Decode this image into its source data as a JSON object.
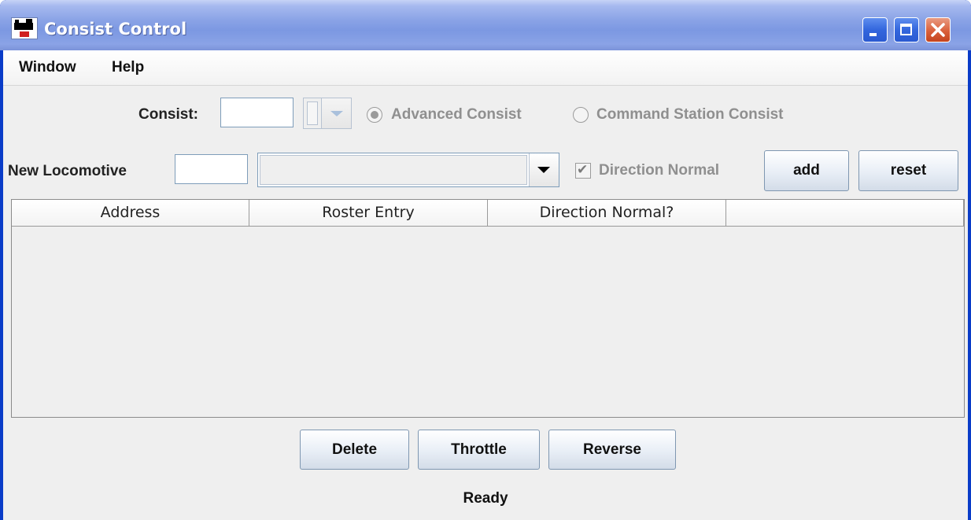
{
  "window": {
    "title": "Consist Control",
    "title_gradient_color": "#7c98e2",
    "close_button_color": "#d9603b"
  },
  "menubar": {
    "items": [
      "Window",
      "Help"
    ]
  },
  "consist_row": {
    "label": "Consist:",
    "address_value": "",
    "selector_value": "",
    "advanced_label": "Advanced Consist",
    "command_station_label": "Command Station Consist",
    "selected_type": "advanced"
  },
  "locomotive_row": {
    "label": "New Locomotive",
    "address_value": "",
    "roster_value": "",
    "direction_label": "Direction Normal",
    "direction_checked": true,
    "add_label": "add",
    "reset_label": "reset"
  },
  "table": {
    "columns": [
      "Address",
      "Roster Entry",
      "Direction Normal?",
      ""
    ],
    "rows": []
  },
  "actions": {
    "delete_label": "Delete",
    "throttle_label": "Throttle",
    "reverse_label": "Reverse"
  },
  "status": {
    "text": "Ready"
  }
}
